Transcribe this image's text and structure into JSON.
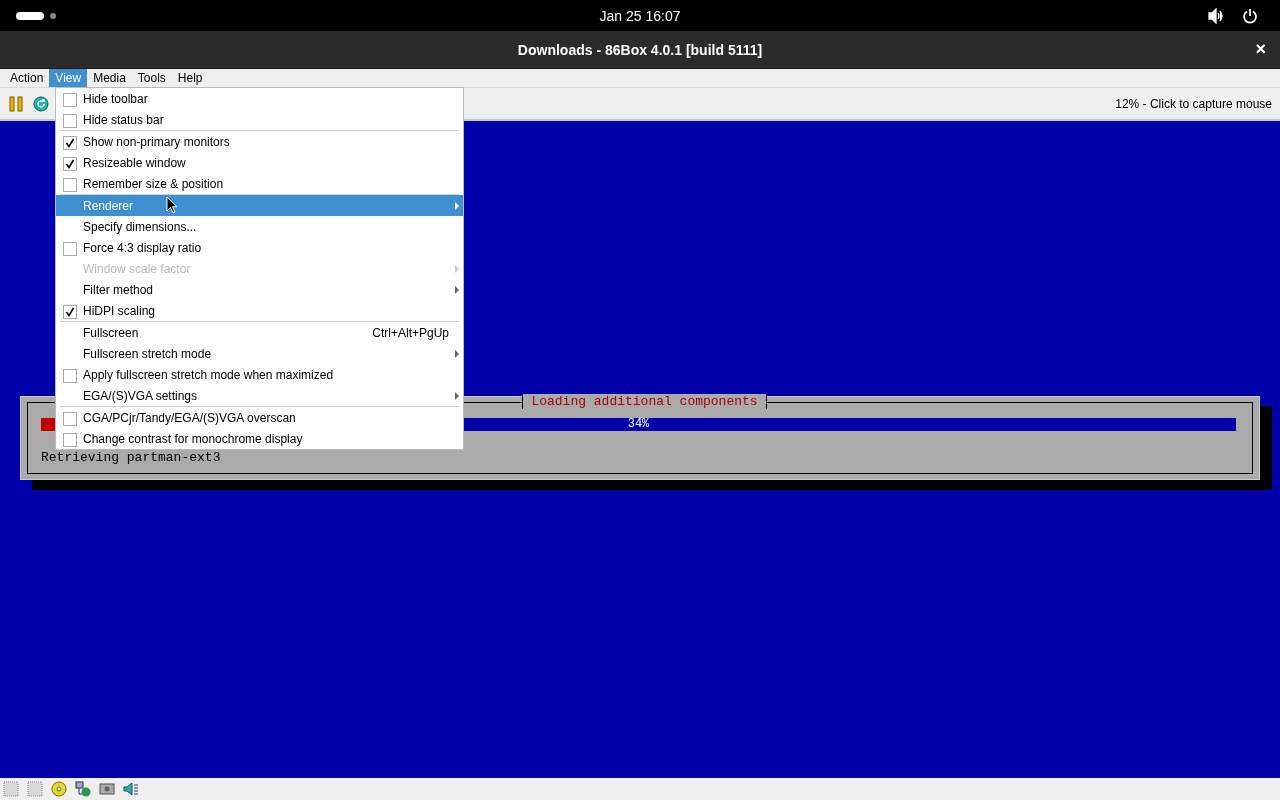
{
  "top_bar": {
    "clock": "Jan 25  16:07"
  },
  "window": {
    "title": "Downloads - 86Box 4.0.1 [build 5111]",
    "close": "×"
  },
  "menu_bar": [
    {
      "label": "Action",
      "selected": false
    },
    {
      "label": "View",
      "selected": true
    },
    {
      "label": "Media",
      "selected": false
    },
    {
      "label": "Tools",
      "selected": false
    },
    {
      "label": "Help",
      "selected": false
    }
  ],
  "toolbar": {
    "status": "12% - Click to capture mouse"
  },
  "view_menu": {
    "groups": [
      [
        {
          "kind": "checkbox",
          "label": "Hide toolbar",
          "checked": false,
          "selected": false,
          "disabled": false
        },
        {
          "kind": "checkbox",
          "label": "Hide status bar",
          "checked": false,
          "selected": false,
          "disabled": false
        }
      ],
      [
        {
          "kind": "checkbox",
          "label": "Show non-primary monitors",
          "checked": true,
          "selected": false,
          "disabled": false
        },
        {
          "kind": "checkbox",
          "label": "Resizeable window",
          "checked": true,
          "selected": false,
          "disabled": false
        },
        {
          "kind": "checkbox",
          "label": "Remember size & position",
          "checked": false,
          "selected": false,
          "disabled": false
        }
      ],
      [
        {
          "kind": "submenu",
          "label": "Renderer",
          "selected": true,
          "disabled": false
        },
        {
          "kind": "action",
          "label": "Specify dimensions...",
          "selected": false,
          "disabled": false
        },
        {
          "kind": "checkbox",
          "label": "Force 4:3 display ratio",
          "checked": false,
          "selected": false,
          "disabled": false
        },
        {
          "kind": "submenu",
          "label": "Window scale factor",
          "selected": false,
          "disabled": true
        },
        {
          "kind": "submenu",
          "label": "Filter method",
          "selected": false,
          "disabled": false
        },
        {
          "kind": "checkbox",
          "label": "HiDPI scaling",
          "checked": true,
          "selected": false,
          "disabled": false
        }
      ],
      [
        {
          "kind": "action",
          "label": "Fullscreen",
          "shortcut": "Ctrl+Alt+PgUp",
          "selected": false,
          "disabled": false
        },
        {
          "kind": "submenu",
          "label": "Fullscreen stretch mode",
          "selected": false,
          "disabled": false
        },
        {
          "kind": "checkbox",
          "label": "Apply fullscreen stretch mode when maximized",
          "checked": false,
          "selected": false,
          "disabled": false
        },
        {
          "kind": "submenu",
          "label": "EGA/(S)VGA settings",
          "selected": false,
          "disabled": false
        }
      ],
      [
        {
          "kind": "checkbox",
          "label": "CGA/PCjr/Tandy/EGA/(S)VGA overscan",
          "checked": false,
          "selected": false,
          "disabled": false
        },
        {
          "kind": "checkbox",
          "label": "Change contrast for monochrome display",
          "checked": false,
          "selected": false,
          "disabled": false
        }
      ]
    ]
  },
  "installer_dialog": {
    "title": "Loading additional components",
    "progress": {
      "level": 0.34,
      "reading": "34%"
    },
    "message": "Retrieving partman-ext3"
  }
}
